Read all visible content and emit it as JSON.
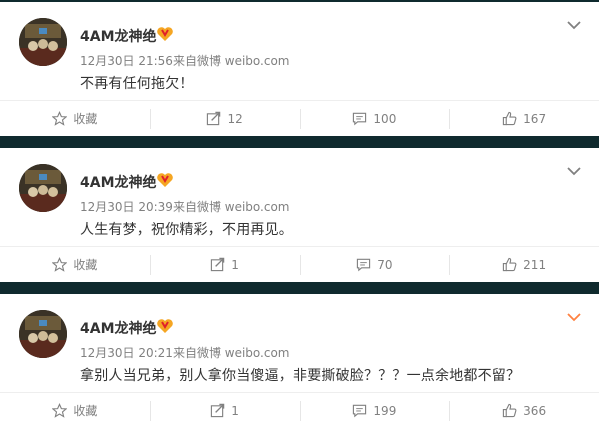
{
  "posts": [
    {
      "username": "4AM龙神绝",
      "time": "12月30日 21:56",
      "source": "来自微博 weibo.com",
      "content": "不再有任何拖欠！",
      "actions": {
        "favorite": "收藏",
        "repost": "12",
        "comment": "100",
        "like": "167"
      },
      "chevron_color": "#808080"
    },
    {
      "username": "4AM龙神绝",
      "time": "12月30日 20:39",
      "source": "来自微博 weibo.com",
      "content": "人生有梦，祝你精彩，不用再见。",
      "actions": {
        "favorite": "收藏",
        "repost": "1",
        "comment": "70",
        "like": "211"
      },
      "chevron_color": "#808080"
    },
    {
      "username": "4AM龙神绝",
      "time": "12月30日 20:21",
      "source": "来自微博 weibo.com",
      "content": "拿别人当兄弟，别人拿你当傻逼，非要撕破脸？？？一点余地都不留？",
      "actions": {
        "favorite": "收藏",
        "repost": "1",
        "comment": "199",
        "like": "366"
      },
      "chevron_color": "#ff8140"
    }
  ],
  "icons": {
    "avatar": "avatar-image",
    "vip": "vip-badge-icon",
    "chevron": "chevron-down-icon",
    "favorite": "star-icon",
    "repost": "repost-icon",
    "comment": "comment-icon",
    "like": "thumbs-up-icon"
  },
  "colors": {
    "background": "#0f2a2e",
    "card": "#ffffff",
    "text": "#333333",
    "meta": "#808080",
    "accent": "#ff8140"
  }
}
